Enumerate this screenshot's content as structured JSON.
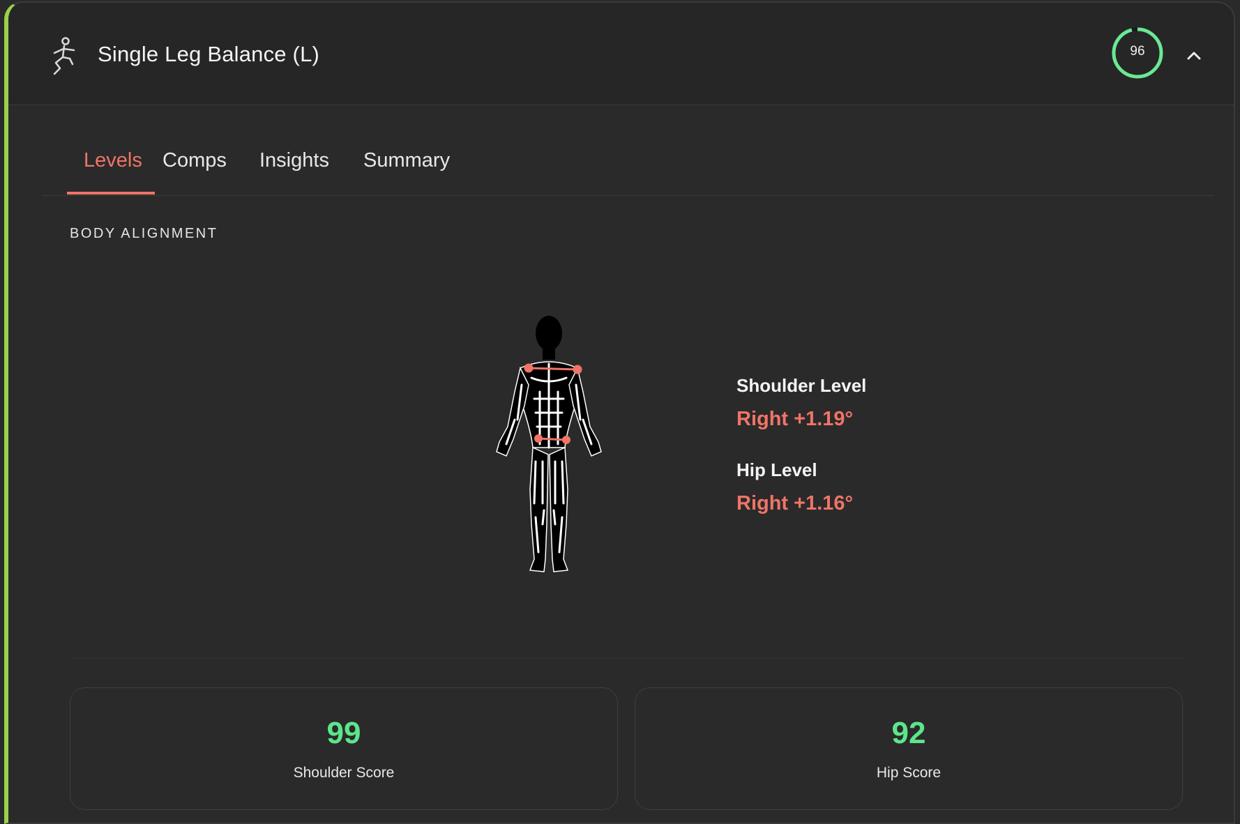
{
  "header": {
    "exercise_icon": "single-leg-balance-icon",
    "title": "Single Leg Balance (L)",
    "overall_score": "96",
    "overall_score_fraction": 0.96,
    "collapse_icon": "chevron-up-icon"
  },
  "tabs": [
    {
      "label": "Levels",
      "active": true
    },
    {
      "label": "Comps",
      "active": false
    },
    {
      "label": "Insights",
      "active": false
    },
    {
      "label": "Summary",
      "active": false
    }
  ],
  "section": {
    "title": "BODY ALIGNMENT"
  },
  "metrics": [
    {
      "label": "Shoulder Level",
      "value": "Right +1.19°"
    },
    {
      "label": "Hip Level",
      "value": "Right +1.16°"
    }
  ],
  "scores": [
    {
      "value": "99",
      "label": "Shoulder Score"
    },
    {
      "value": "92",
      "label": "Hip Score"
    }
  ],
  "colors": {
    "accent_left_bar": "#9ad14b",
    "active_tab": "#f07467",
    "deviation": "#f07467",
    "score_good": "#5de58c",
    "ring": "#6be894"
  }
}
